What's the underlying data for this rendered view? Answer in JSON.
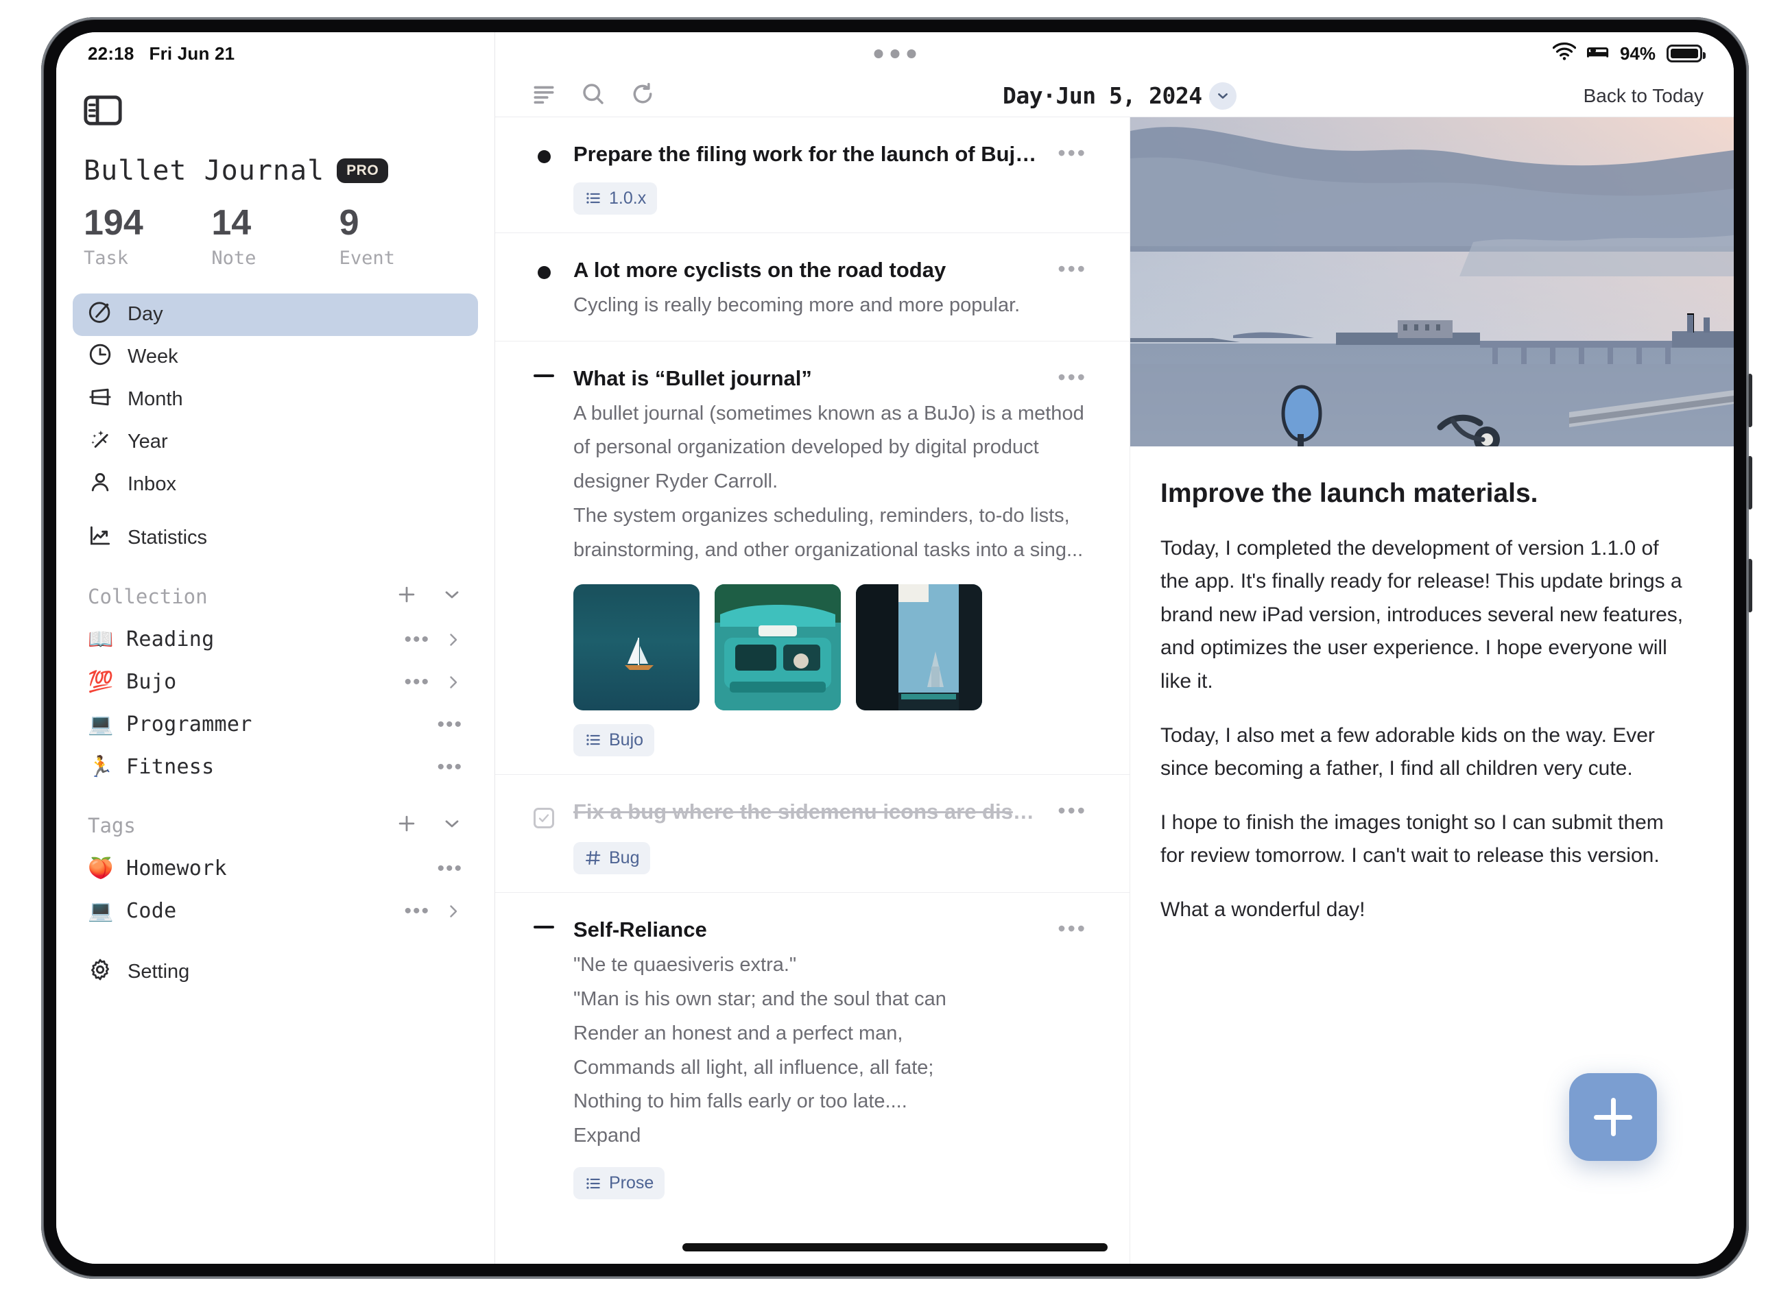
{
  "status_bar": {
    "time": "22:18",
    "date": "Fri Jun 21",
    "wifi_icon": "wifi-icon",
    "focus_icon": "sleep-focus-icon",
    "battery_percent": "94%",
    "battery_icon": "battery-full-icon",
    "handle_icon": "multitasking-handle-icon"
  },
  "sidebar": {
    "toggle_icon": "sidebar-toggle-icon",
    "app_title": "Bullet Journal",
    "pro_badge": "PRO",
    "stats": [
      {
        "value": "194",
        "label": "Task"
      },
      {
        "value": "14",
        "label": "Note"
      },
      {
        "value": "9",
        "label": "Event"
      }
    ],
    "nav": [
      {
        "label": "Day",
        "icon": "day-icon",
        "active": true
      },
      {
        "label": "Week",
        "icon": "clock-icon",
        "active": false
      },
      {
        "label": "Month",
        "icon": "month-icon",
        "active": false
      },
      {
        "label": "Year",
        "icon": "sparkle-wand-icon",
        "active": false
      },
      {
        "label": "Inbox",
        "icon": "person-icon",
        "active": false
      },
      {
        "label": "Statistics",
        "icon": "chart-line-icon",
        "active": false
      }
    ],
    "collection": {
      "title": "Collection",
      "add_icon": "plus-icon",
      "collapse_icon": "chevron-down-icon",
      "items": [
        {
          "emoji": "📖",
          "label": "Reading",
          "has_chevron": true
        },
        {
          "emoji": "💯",
          "label": "Bujo",
          "has_chevron": true
        },
        {
          "emoji": "💻",
          "label": "Programmer",
          "has_chevron": false
        },
        {
          "emoji": "🏃",
          "label": "Fitness",
          "has_chevron": false
        }
      ]
    },
    "tags": {
      "title": "Tags",
      "add_icon": "plus-icon",
      "collapse_icon": "chevron-down-icon",
      "items": [
        {
          "emoji": "🍑",
          "label": "Homework",
          "has_chevron": false
        },
        {
          "emoji": "💻",
          "label": "Code",
          "has_chevron": true
        }
      ]
    },
    "setting": {
      "label": "Setting",
      "icon": "gear-icon"
    }
  },
  "toolbar": {
    "filter_icon": "filter-lines-icon",
    "search_icon": "search-icon",
    "refresh_icon": "refresh-icon",
    "title": "Day·Jun 5, 2024",
    "dropdown_icon": "chevron-down-icon",
    "back_to_today": "Back to Today"
  },
  "entries": [
    {
      "marker": "dot",
      "title": "Prepare the filing work for the launch of Bujo...",
      "body": [],
      "expand": null,
      "tags": [
        {
          "icon": "list-icon",
          "label": "1.0.x"
        }
      ],
      "images": [],
      "completed": false
    },
    {
      "marker": "dot",
      "title": "A lot more cyclists on the road today",
      "body": [
        "Cycling is really becoming more and more popular."
      ],
      "expand": null,
      "tags": [],
      "images": [],
      "completed": false
    },
    {
      "marker": "dash",
      "title": "What is “Bullet journal”",
      "body": [
        "A bullet journal (sometimes known as a BuJo) is a method of personal organization developed by digital product designer Ryder Carroll.",
        "The system organizes scheduling, reminders, to-do lists, brainstorming, and other organizational tasks into a sing..."
      ],
      "expand": null,
      "tags": [
        {
          "icon": "list-icon",
          "label": "Bujo"
        }
      ],
      "images": [
        "sailboat-photo",
        "teal-taxi-photo",
        "street-temple-photo"
      ],
      "completed": false
    },
    {
      "marker": "check",
      "title": "Fix a bug where the sidemenu icons are disp...",
      "body": [],
      "expand": null,
      "tags": [
        {
          "icon": "hash-icon",
          "label": "Bug"
        }
      ],
      "images": [],
      "completed": true
    },
    {
      "marker": "dash",
      "title": "Self-Reliance",
      "body": [
        "\"Ne te quaesiveris extra.\"",
        "\"Man is his own star; and the soul that can",
        "Render an honest and a perfect man,",
        "Commands all light, all influence, all fate;",
        "Nothing to him falls early or too late...."
      ],
      "expand": "Expand",
      "tags": [
        {
          "icon": "list-icon",
          "label": "Prose"
        }
      ],
      "images": [],
      "completed": false
    }
  ],
  "note": {
    "hero_image": "coastal-dusk-photo",
    "title": "Improve the launch materials.",
    "paragraphs": [
      "Today, I completed the development of version 1.1.0 of the app. It's finally ready for release! This update brings a brand new iPad version, introduces several new features, and optimizes the user experience. I hope everyone will like it.",
      "Today, I also met a few adorable kids on the way. Ever since becoming a father, I find all children very cute.",
      "I hope to finish the images tonight so I can submit them for review tomorrow. I can't wait to release this version.",
      "What a wonderful day!"
    ],
    "add_button_icon": "plus-icon"
  },
  "colors": {
    "accent_blue": "#7b9ed1",
    "active_nav": "#c5d2e6",
    "chip_bg": "#eef1f6",
    "chip_text": "#4d6393",
    "link": "#5f7fb5"
  }
}
